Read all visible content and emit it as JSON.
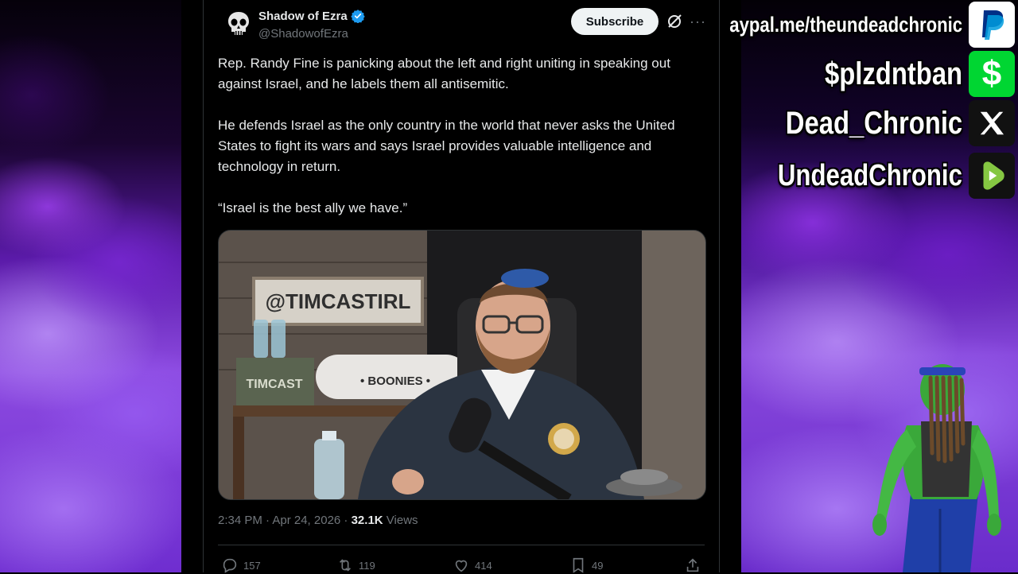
{
  "tweet": {
    "display_name": "Shadow of Ezra",
    "handle": "@ShadowofEzra",
    "subscribe_label": "Subscribe",
    "more_label": "···",
    "text": "Rep. Randy Fine is panicking about the left and right uniting in speaking out against Israel, and he labels them all antisemitic.\n\nHe defends Israel as the only country in the world that never asks the United States to fight its wars and says Israel provides valuable intelligence and technology in return.\n\n“Israel is the best ally we have.”",
    "timestamp": "2:34 PM · Apr 24, 2026 · ",
    "views_count": "32.1K",
    "views_label": " Views",
    "actions": {
      "replies": "157",
      "reposts": "119",
      "likes": "414",
      "bookmarks": "49"
    },
    "media": {
      "sign_text": "@TIMCASTIRL",
      "box_text": "TIMCAST",
      "board_text": "• BOONIES •"
    }
  },
  "overlay": {
    "paypal": "aypal.me/theundeadchronic",
    "cashapp": "$plzdntban",
    "x_handle": "Dead_Chronic",
    "rumble": "UndeadChronic"
  },
  "colors": {
    "paypal_blue": "#003087",
    "cashapp_green": "#00d632",
    "rumble_green": "#85c742",
    "verified_blue": "#1d9bf0"
  }
}
